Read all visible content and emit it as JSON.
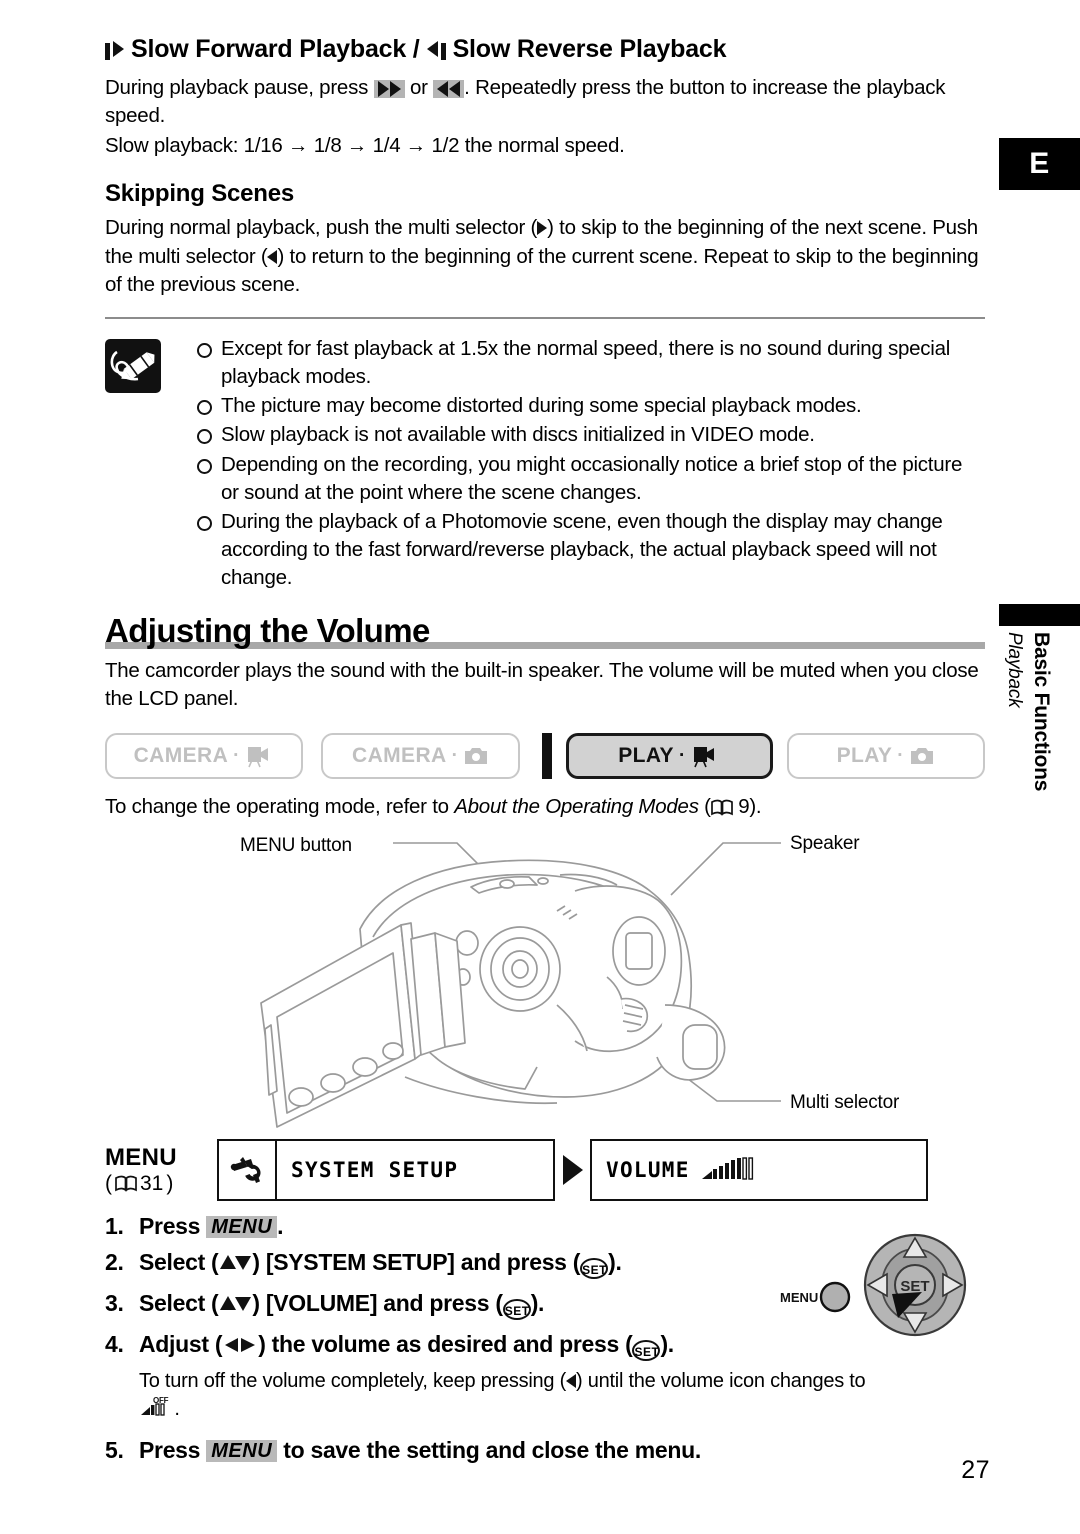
{
  "document": {
    "page_number": "27",
    "language_tab": "E"
  },
  "sidebar": {
    "chapter": "Basic Functions",
    "subchapter": "Playback"
  },
  "slow_playback": {
    "heading_part1": "Slow Forward Playback /",
    "heading_part2": "Slow Reverse Playback",
    "para1_a": "During playback pause, press",
    "para1_or": "or",
    "para1_b": ". Repeatedly press the button to increase the playback speed.",
    "para2": "Slow playback: 1/16 → 1/8 → 1/4 → 1/2 the normal speed."
  },
  "skipping_scenes": {
    "heading": "Skipping Scenes",
    "text_a": "During normal playback, push the multi selector (",
    "text_b": ") to skip to the beginning of the next scene. Push the multi selector (",
    "text_c": ") to return to the beginning of the current scene. Repeat to skip to the beginning of the previous scene."
  },
  "notes": {
    "icon": "note-pencil-icon",
    "items": [
      "Except for fast playback at 1.5x the normal speed, there is no sound during special playback modes.",
      "The picture may become distorted during some special playback modes.",
      "Slow playback is not available with discs initialized in VIDEO mode.",
      "Depending on the recording, you might occasionally notice a brief stop of the picture or sound at the point where the scene changes.",
      "During the playback of a Photomovie scene, even though the display may change according to the fast forward/reverse playback, the actual playback speed will not change."
    ]
  },
  "volume_section": {
    "title": "Adjusting the Volume",
    "intro": "The camcorder plays the sound with the built-in speaker. The volume will be muted when you close the LCD panel.",
    "modes": [
      {
        "label": "CAMERA",
        "icon": "video-camera-icon",
        "active": false
      },
      {
        "label": "CAMERA",
        "icon": "still-camera-icon",
        "active": false
      },
      {
        "label": "PLAY",
        "icon": "video-camera-icon",
        "active": true
      },
      {
        "label": "PLAY",
        "icon": "still-camera-icon",
        "active": false
      }
    ],
    "mode_note_a": "To change the operating mode, refer to ",
    "mode_note_italic": "About the Operating Modes",
    "mode_note_b": " (",
    "mode_note_page": "9",
    "mode_note_c": ")."
  },
  "figure_callouts": {
    "menu_button": "MENU button",
    "speaker": "Speaker",
    "multi_selector": "Multi selector"
  },
  "menu_flow": {
    "title": "MENU",
    "ref_page": "31",
    "item1": {
      "label": "SYSTEM SETUP",
      "icon": "wrench-setup-icon"
    },
    "item2": {
      "label": "VOLUME",
      "icon": "volume-bars-icon"
    }
  },
  "steps": {
    "s1_a": "Press",
    "s1_chip": "MENU",
    "s1_b": ".",
    "s2_a": "Select (",
    "s2_b": ") [SYSTEM SETUP] and press (",
    "s2_set": "SET",
    "s2_c": ").",
    "s3_a": "Select (",
    "s3_b": ") [VOLUME] and press (",
    "s3_set": "SET",
    "s3_c": ").",
    "s4_a": "Adjust (",
    "s4_b": ") the volume as desired and press (",
    "s4_set": "SET",
    "s4_c": ").",
    "s4_note_a": "To turn off the volume completely, keep pressing (",
    "s4_note_b": ") until the volume icon changes to",
    "s4_note_c": ".",
    "s4_note_icon": "speaker-off-icon",
    "s5_a": "Press",
    "s5_chip": "MENU",
    "s5_b": "to save the setting and close the menu."
  },
  "selector_figure": {
    "menu_label": "MENU",
    "set_label": "SET"
  },
  "colors": {
    "rule_grey": "#a8a8a8",
    "chip_grey": "#b9b9b9",
    "mode_inactive": "#c0c0c0",
    "mode_active_bg": "#d2d2d2",
    "black": "#000000"
  }
}
